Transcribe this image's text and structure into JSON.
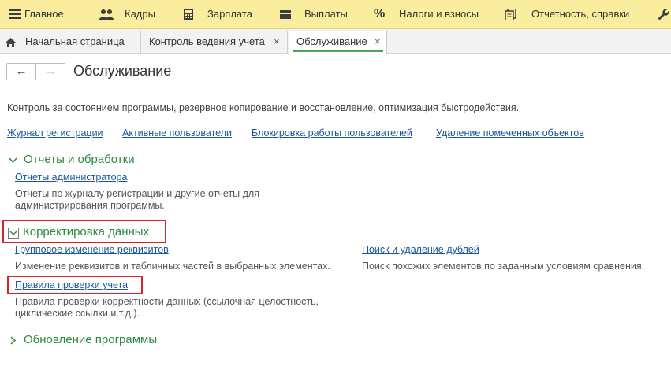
{
  "menubar": {
    "items": [
      {
        "label": "Главное",
        "icon": "hamburger-icon"
      },
      {
        "label": "Кадры",
        "icon": "people-icon"
      },
      {
        "label": "Зарплата",
        "icon": "calculator-icon"
      },
      {
        "label": "Выплаты",
        "icon": "wallet-icon"
      },
      {
        "label": "Налоги и взносы",
        "icon": "percent-icon"
      },
      {
        "label": "Отчетность, справки",
        "icon": "reports-icon"
      },
      {
        "label": "",
        "icon": "wrench-icon"
      }
    ]
  },
  "tabs": [
    {
      "label": "Начальная страница",
      "home_icon": "home-icon",
      "closable": false,
      "active": false
    },
    {
      "label": "Контроль ведения учета",
      "closable": true,
      "active": false
    },
    {
      "label": "Обслуживание",
      "closable": true,
      "active": true
    }
  ],
  "tab_close_glyph": "×",
  "nav": {
    "back_glyph": "←",
    "forward_glyph": "→"
  },
  "page": {
    "title": "Обслуживание",
    "description": "Контроль за состоянием программы, резервное копирование и восстановление, оптимизация быстродействия."
  },
  "top_links": [
    "Журнал регистрации",
    "Активные пользователи",
    "Блокировка работы пользователей",
    "Удаление помеченных объектов"
  ],
  "groups": {
    "reports": {
      "title": "Отчеты и обработки",
      "expanded": true,
      "link": "Отчеты администратора",
      "note_line1": "Отчеты по журналу регистрации и другие отчеты для",
      "note_line2": "администрирования программы."
    },
    "correction": {
      "title": "Корректировка данных",
      "expanded": true,
      "highlight_color": "#d9222a",
      "left_link": "Групповое изменение реквизитов",
      "left_note": "Изменение реквизитов и табличных частей в выбранных элементах.",
      "right_link": "Поиск и удаление дублей",
      "right_note": "Поиск похожих элементов по заданным условиям сравнения.",
      "rules_link": "Правила проверки учета",
      "rules_note_line1": "Правила проверки корректности данных (ссылочная целостность,",
      "rules_note_line2": "циклические ссылки и.т.д.)."
    },
    "update": {
      "title": "Обновление программы",
      "expanded": false
    }
  },
  "colors": {
    "menubar_bg": "#fbed9e",
    "link": "#1b57a1",
    "group_header": "#2e8b3e",
    "active_tab_underline": "#4da25a"
  }
}
